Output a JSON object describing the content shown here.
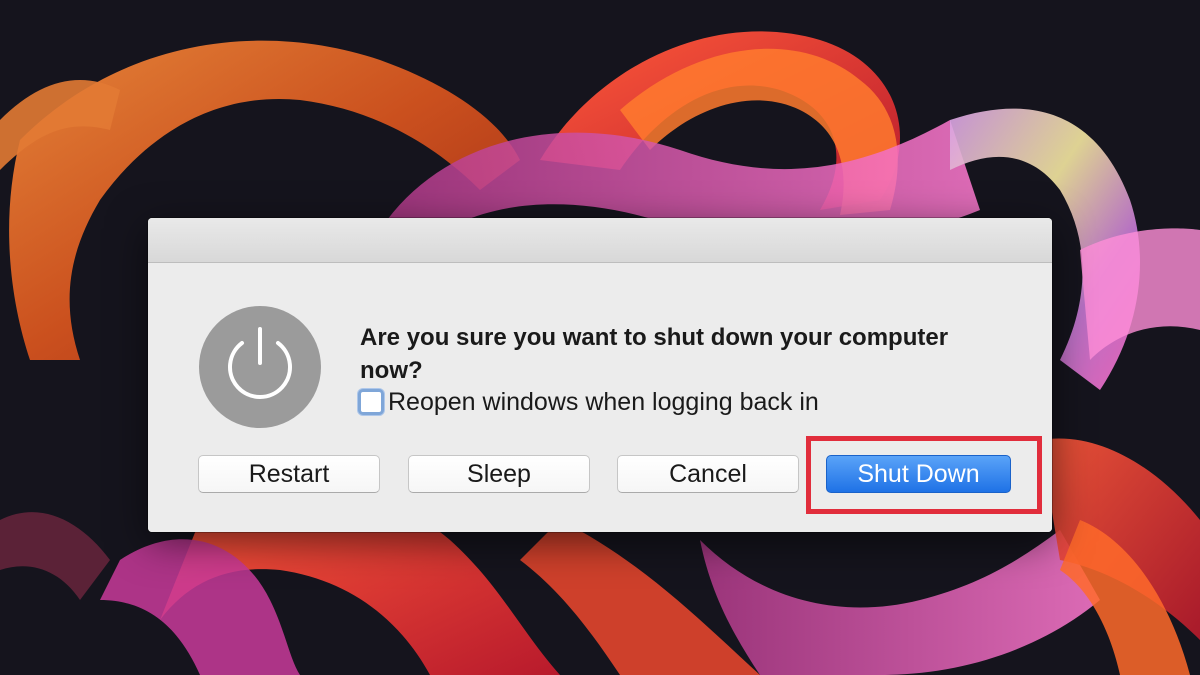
{
  "dialog": {
    "message": "Are you sure you want to shut down your computer now?",
    "reopen_label": "Reopen windows when logging back in",
    "reopen_checked": false,
    "icon": "power-icon",
    "buttons": {
      "restart": "Restart",
      "sleep": "Sleep",
      "cancel": "Cancel",
      "shutdown": "Shut Down"
    }
  },
  "colors": {
    "primary_button": "#2a7de9",
    "highlight_box": "#e12d3c",
    "dialog_bg": "#ececec"
  }
}
